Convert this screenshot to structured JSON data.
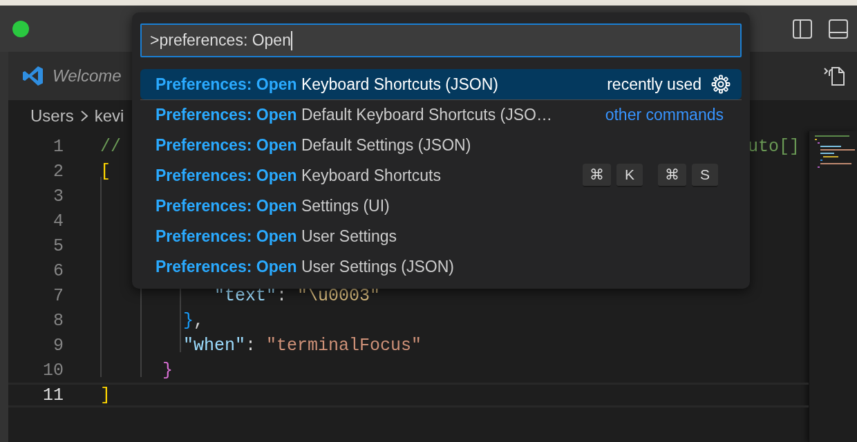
{
  "tab": {
    "title": "Welcome"
  },
  "breadcrumb": [
    "Users",
    "kevi"
  ],
  "editor": {
    "lines": [
      {
        "number": "1",
        "current": false,
        "tokens": [
          {
            "text": "//",
            "kind": "comment"
          }
        ],
        "tail": {
          "text": "uto[]",
          "kind": "comment"
        }
      },
      {
        "number": "2",
        "current": false,
        "tokens": [
          {
            "text": "[",
            "kind": "bracket1"
          }
        ]
      },
      {
        "number": "3",
        "current": false
      },
      {
        "number": "4",
        "current": false
      },
      {
        "number": "5",
        "current": false
      },
      {
        "number": "6",
        "current": false
      },
      {
        "number": "7",
        "current": false,
        "tokens": [
          {
            "text": "           \"text\"",
            "kind": "key"
          },
          {
            "text": ": ",
            "kind": "punct"
          },
          {
            "text": "\"\\u0003\"",
            "kind": "string"
          }
        ]
      },
      {
        "number": "8",
        "current": false,
        "tokens": [
          {
            "text": "        }",
            "kind": "bracket3"
          },
          {
            "text": ",",
            "kind": "punct"
          }
        ]
      },
      {
        "number": "9",
        "current": false,
        "tokens": [
          {
            "text": "        \"when\"",
            "kind": "key"
          },
          {
            "text": ": ",
            "kind": "punct"
          },
          {
            "text": "\"terminalFocus\"",
            "kind": "value"
          }
        ]
      },
      {
        "number": "10",
        "current": false,
        "tokens": [
          {
            "text": "      }",
            "kind": "bracket2"
          }
        ]
      },
      {
        "number": "11",
        "current": true,
        "tokens": [
          {
            "text": "]",
            "kind": "bracket1"
          }
        ]
      }
    ]
  },
  "command_palette": {
    "input": {
      "value": ">preferences: Open"
    },
    "items": [
      {
        "match": "Preferences: Open",
        "label": "Keyboard Shortcuts (JSON)",
        "selected": true,
        "detail": {
          "text": "recently used",
          "kind": "plain"
        },
        "gear": true
      },
      {
        "match": "Preferences: Open",
        "label": "Default Keyboard Shortcuts (JSO…",
        "selected": false,
        "separator": true,
        "detail": {
          "text": "other commands",
          "kind": "link"
        }
      },
      {
        "match": "Preferences: Open",
        "label": "Default Settings (JSON)",
        "selected": false
      },
      {
        "match": "Preferences: Open",
        "label": "Keyboard Shortcuts",
        "selected": false,
        "keys": [
          [
            "⌘",
            "K"
          ],
          [
            "⌘",
            "S"
          ]
        ]
      },
      {
        "match": "Preferences: Open",
        "label": "Settings (UI)",
        "selected": false
      },
      {
        "match": "Preferences: Open",
        "label": "User Settings",
        "selected": false
      },
      {
        "match": "Preferences: Open",
        "label": "User Settings (JSON)",
        "selected": false
      }
    ]
  }
}
